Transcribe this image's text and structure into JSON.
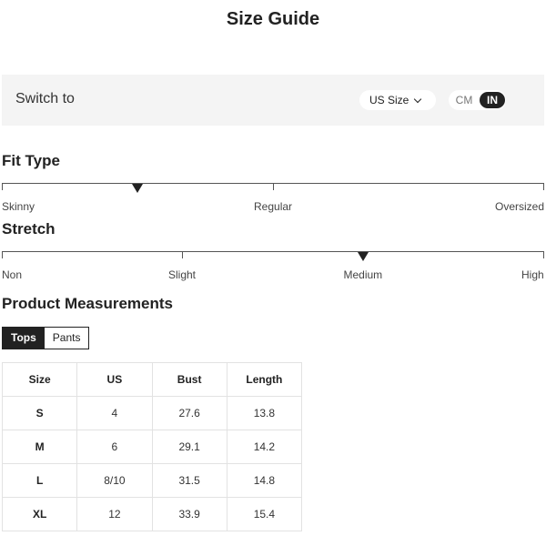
{
  "title": "Size Guide",
  "switch_bar": {
    "label": "Switch to",
    "size_select": "US Size",
    "units": {
      "cm": "CM",
      "in": "IN",
      "selected": "IN"
    }
  },
  "fit_type": {
    "title": "Fit Type",
    "labels": [
      "Skinny",
      "Regular",
      "Oversized"
    ],
    "selected_position": 0.25
  },
  "stretch": {
    "title": "Stretch",
    "labels": [
      "Non",
      "Slight",
      "Medium",
      "High"
    ],
    "selected_position": 0.667
  },
  "measurements": {
    "title": "Product Measurements",
    "tabs": [
      "Tops",
      "Pants"
    ],
    "active_tab": "Tops",
    "headers": [
      "Size",
      "US",
      "Bust",
      "Length"
    ],
    "rows": [
      [
        "S",
        "4",
        "27.6",
        "13.8"
      ],
      [
        "M",
        "6",
        "29.1",
        "14.2"
      ],
      [
        "L",
        "8/10",
        "31.5",
        "14.8"
      ],
      [
        "XL",
        "12",
        "33.9",
        "15.4"
      ]
    ]
  }
}
